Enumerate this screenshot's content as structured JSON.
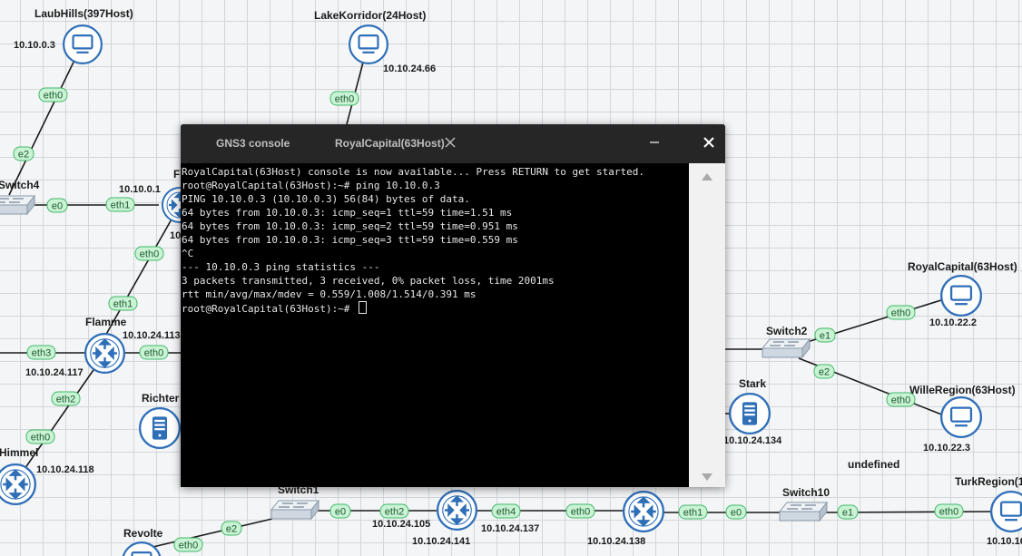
{
  "nodes": {
    "laubhills": {
      "name": "LaubHills(397Host)",
      "ip": "10.10.0.3"
    },
    "lakekorridor": {
      "name": "LakeKorridor(24Host)",
      "ip": "10.10.24.66"
    },
    "switch4": {
      "name": "Switch4"
    },
    "f_router": {
      "name": "F",
      "ip": "10.10.0.1",
      "ip2": "10"
    },
    "flamme": {
      "name": "Flamme",
      "ip": "10.10.24.117",
      "ip2": "10.10.24.113"
    },
    "richter": {
      "name": "Richter"
    },
    "himmel": {
      "name": "Himmel",
      "ip": "10.10.24.118"
    },
    "revolte": {
      "name": "Revolte"
    },
    "switch1": {
      "name": "Switch1"
    },
    "router_a": {
      "ip": "10.10.24.105",
      "ip2": "10.10.24.141",
      "ip3": "10.10.24.137"
    },
    "router_b": {
      "ip": "10.10.24.138"
    },
    "switch10": {
      "name": "Switch10"
    },
    "turkregion": {
      "name": "TurkRegion(1",
      "ip": "10.10.16"
    },
    "switch2": {
      "name": "Switch2"
    },
    "stark": {
      "name": "Stark",
      "ip": "10.10.24.134"
    },
    "royalcapital": {
      "name": "RoyalCapital(63Host)",
      "ip": "10.10.22.2"
    },
    "willeregion": {
      "name": "WilleRegion(63Host)",
      "ip": "10.10.22.3"
    },
    "undefined_label": "undefined"
  },
  "ports": {
    "eth0": "eth0",
    "eth1": "eth1",
    "eth2": "eth2",
    "eth3": "eth3",
    "eth4": "eth4",
    "e0": "e0",
    "e1": "e1",
    "e2": "e2"
  },
  "console": {
    "tab_gns": "GNS3 console",
    "tab_active": "RoyalCapital(63Host)",
    "lines": [
      "RoyalCapital(63Host) console is now available... Press RETURN to get started.",
      "root@RoyalCapital(63Host):~# ping 10.10.0.3",
      "PING 10.10.0.3 (10.10.0.3) 56(84) bytes of data.",
      "64 bytes from 10.10.0.3: icmp_seq=1 ttl=59 time=1.51 ms",
      "64 bytes from 10.10.0.3: icmp_seq=2 ttl=59 time=0.951 ms",
      "64 bytes from 10.10.0.3: icmp_seq=3 ttl=59 time=0.559 ms",
      "^C",
      "--- 10.10.0.3 ping statistics ---",
      "3 packets transmitted, 3 received, 0% packet loss, time 2001ms",
      "rtt min/avg/max/mdev = 0.559/1.008/1.514/0.391 ms",
      "root@RoyalCapital(63Host):~# "
    ]
  },
  "colors": {
    "node_blue": "#2f6fb8",
    "badge_green": "#c9f3d4",
    "terminal_bg": "#000000"
  }
}
